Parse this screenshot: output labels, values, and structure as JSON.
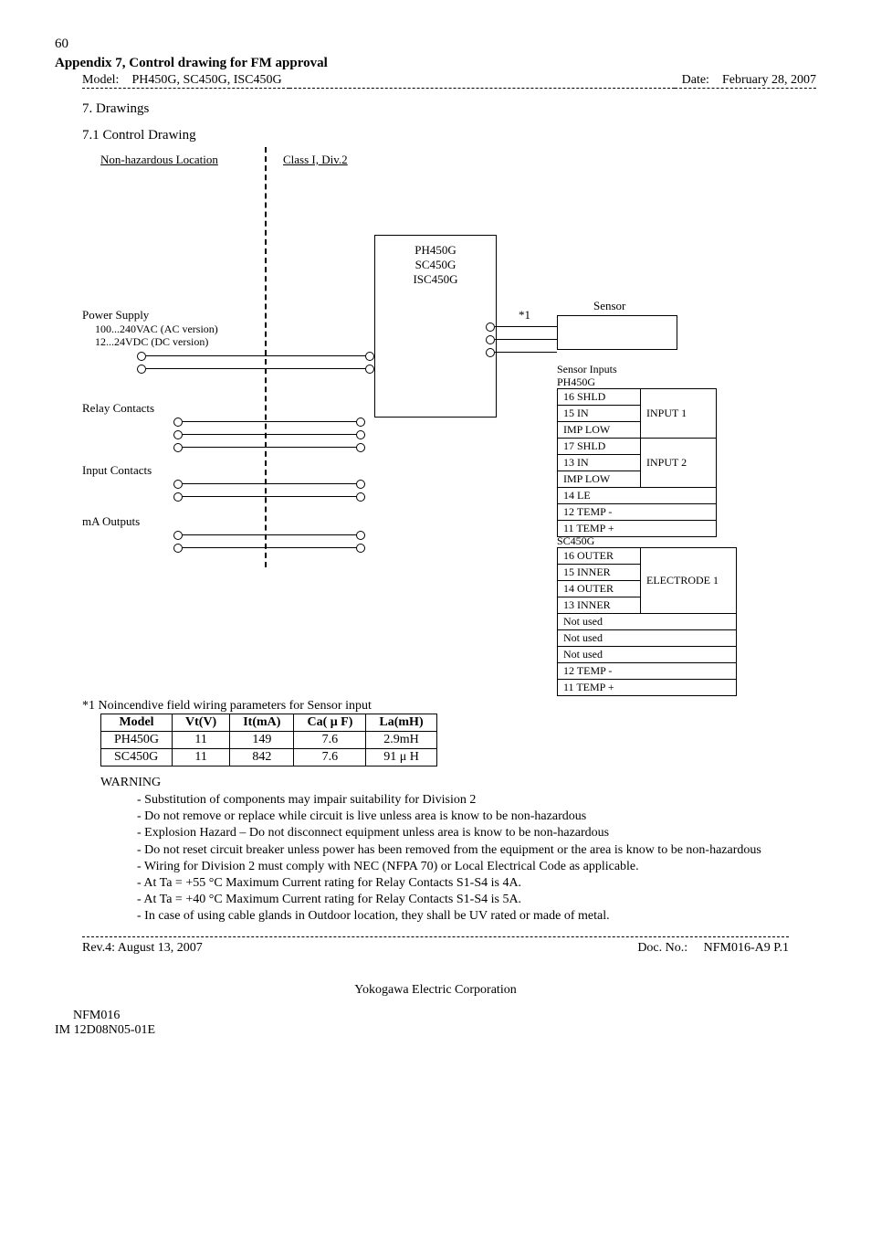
{
  "page_number": "60",
  "appendix_title": "Appendix 7, Control drawing for FM approval",
  "model_label": "Model:",
  "model_value": "PH450G, SC450G, ISC450G",
  "date_label": "Date:",
  "date_value": "February 28, 2007",
  "section7": "7.   Drawings",
  "section71": "7.1 Control Drawing",
  "diagram": {
    "nonhaz": "Non-hazardous Location",
    "class": "Class I, Div.2",
    "device_lines": [
      "PH450G",
      "SC450G",
      "ISC450G"
    ],
    "star1": "*1",
    "sensor": "Sensor",
    "power_supply": "Power Supply",
    "ps_line1": "100...240VAC (AC version)",
    "ps_line2": "12...24VDC (DC version)",
    "relay": "Relay Contacts",
    "input": "Input Contacts",
    "ma": "mA Outputs",
    "sensor_inputs": "Sensor Inputs",
    "ph450g_label": "PH450G",
    "ph450g_rows": [
      "16 SHLD",
      "15 IN",
      "IMP LOW",
      "17 SHLD",
      "13 IN",
      "IMP LOW",
      "14 LE",
      "12 TEMP -",
      "11 TEMP +"
    ],
    "ph450g_groups": [
      "INPUT 1",
      "INPUT 2"
    ],
    "sc450g_label": "SC450G",
    "sc450g_rows": [
      "16 OUTER",
      "15 INNER",
      "14 OUTER",
      "13 INNER",
      "Not used",
      "Not used",
      "Not used",
      "12 TEMP -",
      "11 TEMP +"
    ],
    "sc450g_group": "ELECTRODE 1"
  },
  "params_caption": "*1   Noincendive field wiring parameters for Sensor input",
  "params": {
    "headers": [
      "Model",
      "Vt(V)",
      "It(mA)",
      "Ca( μ F)",
      "La(mH)"
    ],
    "rows": [
      [
        "PH450G",
        "11",
        "149",
        "7.6",
        "2.9mH"
      ],
      [
        "SC450G",
        "11",
        "842",
        "7.6",
        "91 μ H"
      ]
    ]
  },
  "warning_head": "WARNING",
  "warnings": [
    "Substitution of components may impair suitability for Division 2",
    "Do not remove or replace while circuit is live unless area is know to be non-hazardous",
    "Explosion Hazard – Do not disconnect equipment unless area is know to be non-hazardous",
    "Do not reset circuit breaker unless power has been removed from the equipment or the area is know to be non-hazardous",
    "Wiring for Division 2 must comply with NEC (NFPA 70) or Local Electrical Code as applicable.",
    "At Ta = +55 °C Maximum Current rating for Relay Contacts S1-S4 is 4A.",
    "At Ta = +40 °C Maximum Current rating for Relay Contacts S1-S4 is 5A.",
    "In case of using cable glands in Outdoor location, they shall be UV rated or made of metal."
  ],
  "rev": "Rev.4: August 13, 2007",
  "doc_label": "Doc. No.:",
  "doc_value": "NFM016-A9 P.1",
  "footer_company": "Yokogawa Electric Corporation",
  "footer_code": "NFM016",
  "footer_im": "IM 12D08N05-01E"
}
